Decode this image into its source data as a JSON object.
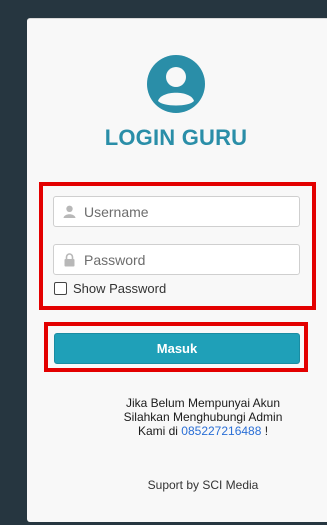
{
  "login": {
    "title": "LOGIN GURU",
    "username_placeholder": "Username",
    "password_placeholder": "Password",
    "show_password_label": "Show Password",
    "submit_label": "Masuk"
  },
  "info": {
    "line1": "Jika Belum Mempunyai Akun",
    "line2": "Silahkan Menghubungi Admin",
    "line3_prefix": "Kami di ",
    "phone": "085227216488",
    "line3_suffix": " !"
  },
  "footer": {
    "text": "Suport by SCI Media"
  },
  "icons": {
    "avatar": "user-circle-icon",
    "username": "user-icon",
    "password": "lock-icon"
  },
  "colors": {
    "accent": "#2a8ea8",
    "button": "#1fa0b8",
    "highlight": "#e30000",
    "backdrop": "#263640",
    "link": "#2a6fd6"
  }
}
